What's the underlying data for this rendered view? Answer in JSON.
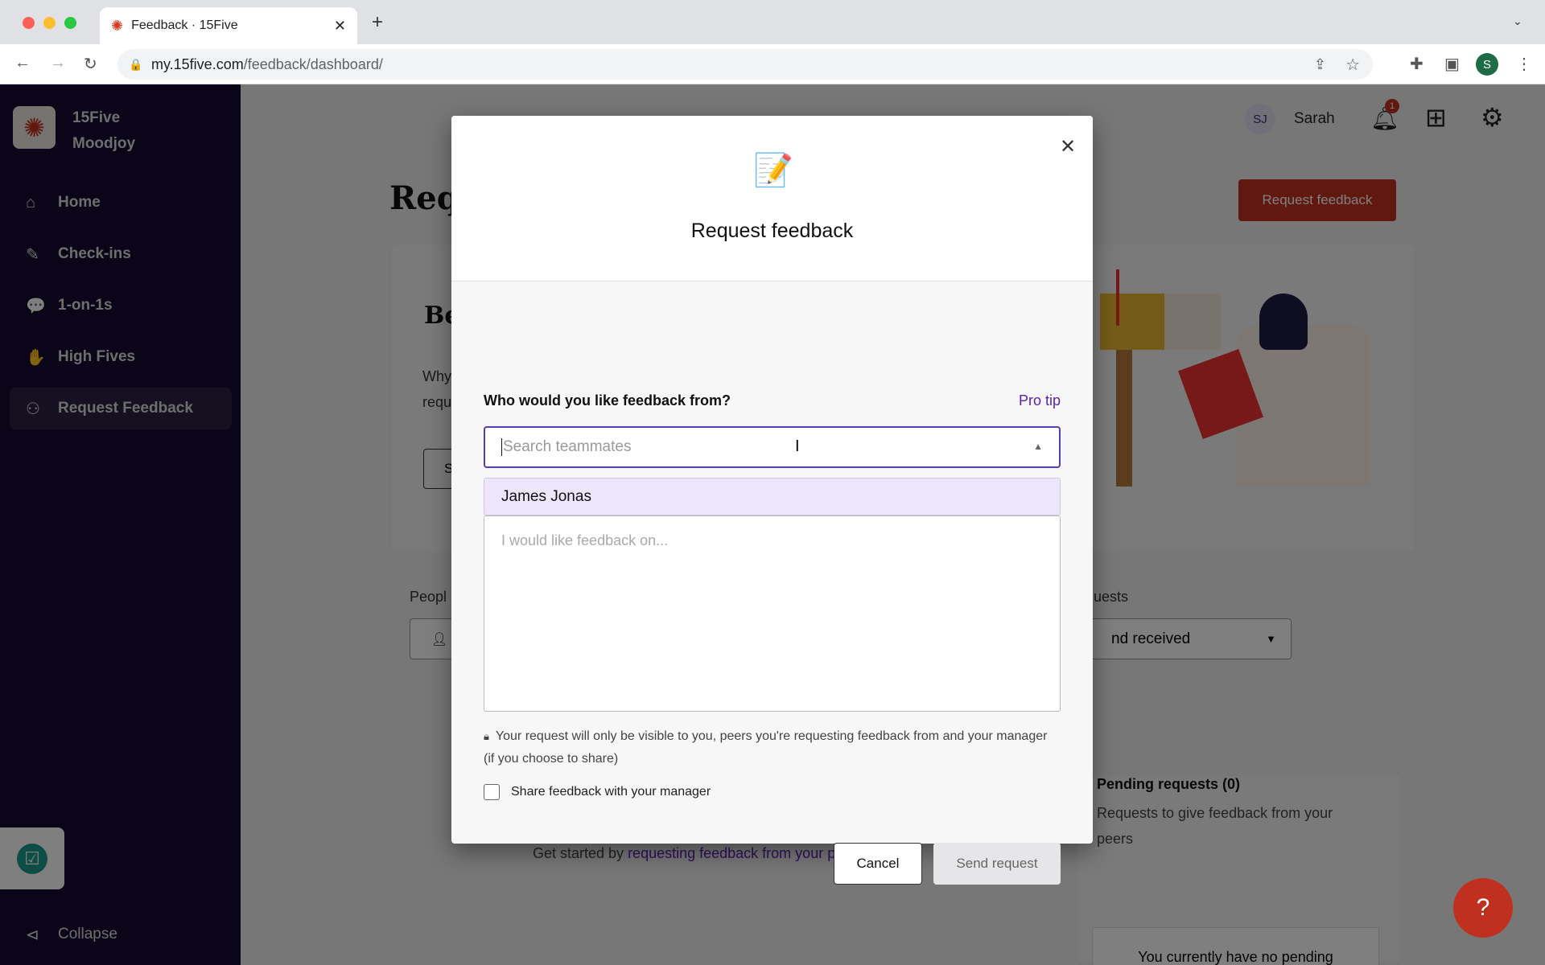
{
  "browser": {
    "tab_title": "Feedback · 15Five",
    "url_domain": "my.15five.com",
    "url_path": "/feedback/dashboard/",
    "profile_initial": "S"
  },
  "sidebar": {
    "org_line1": "15Five",
    "org_line2": "Moodjoy",
    "items": [
      {
        "label": "Home"
      },
      {
        "label": "Check-ins"
      },
      {
        "label": "1-on-1s"
      },
      {
        "label": "High Fives"
      },
      {
        "label": "Request Feedback"
      }
    ],
    "collapse": "Collapse"
  },
  "header": {
    "avatar_initials": "SJ",
    "user_name": "Sarah",
    "notification_count": "1"
  },
  "page": {
    "title_partial": "Req",
    "request_button": "Request feedback",
    "section_partial": "Be",
    "why_partial": "Why",
    "requ_partial": "requ",
    "button_partial": "S",
    "people_partial": "Peopl",
    "requests_partial": "uests",
    "filter_value_partial": "nd received",
    "pending_title": "Pending requests (0)",
    "pending_desc": "Requests to give feedback from your peers",
    "pending_empty": "You currently have no pending requests from your peers.",
    "get_started": "Get started by ",
    "get_started_link": "requesting feedback from your peers."
  },
  "modal": {
    "title": "Request feedback",
    "question": "Who would you like feedback from?",
    "pro_tip": "Pro tip",
    "search_placeholder": "Search teammates",
    "option": "James Jonas",
    "textarea_placeholder": "I would like feedback on...",
    "privacy_note": "Your request will only be visible to you, peers you're requesting feedback from and your manager (if you choose to share)",
    "share_label": "Share feedback with your manager",
    "share_checked": false,
    "cancel": "Cancel",
    "send": "Send request"
  },
  "colors": {
    "brand_red": "#c0301f",
    "sidebar": "#140a30",
    "link_purple": "#5b21b6",
    "option_highlight": "#ede6fb"
  }
}
